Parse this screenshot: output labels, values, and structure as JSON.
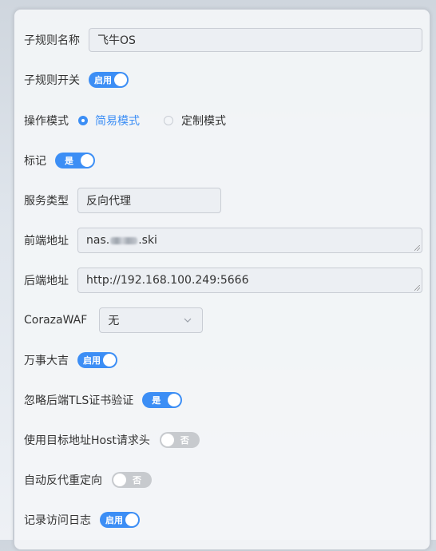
{
  "form": {
    "rule_name": {
      "label": "子规则名称",
      "value": "飞牛OS"
    },
    "rule_switch": {
      "label": "子规则开关",
      "toggle": "启用",
      "on": true
    },
    "mode": {
      "label": "操作模式",
      "options": [
        "简易模式",
        "定制模式"
      ],
      "selected": "简易模式"
    },
    "mark": {
      "label": "标记",
      "toggle": "是",
      "on": true
    },
    "service_type": {
      "label": "服务类型",
      "value": "反向代理"
    },
    "frontend": {
      "label": "前端地址",
      "value_prefix": "nas.",
      "value_suffix": ".ski"
    },
    "backend": {
      "label": "后端地址",
      "value": "http://192.168.100.249:5666"
    },
    "waf": {
      "label": "CorazaWAF",
      "value": "无"
    },
    "lucky": {
      "label": "万事大吉",
      "toggle": "启用",
      "on": true
    },
    "ignore_tls": {
      "label": "忽略后端TLS证书验证",
      "toggle": "是",
      "on": true
    },
    "use_host": {
      "label": "使用目标地址Host请求头",
      "toggle": "否",
      "on": false
    },
    "auto_redirect": {
      "label": "自动反代重定向",
      "toggle": "否",
      "on": false
    },
    "access_log": {
      "label": "记录访问日志",
      "toggle": "启用",
      "on": true
    }
  },
  "colors": {
    "accent": "#3c8ef5",
    "toggle_off": "#c7cace",
    "text": "#333333"
  },
  "icons": {
    "select_arrow": "chevron-down-icon"
  }
}
